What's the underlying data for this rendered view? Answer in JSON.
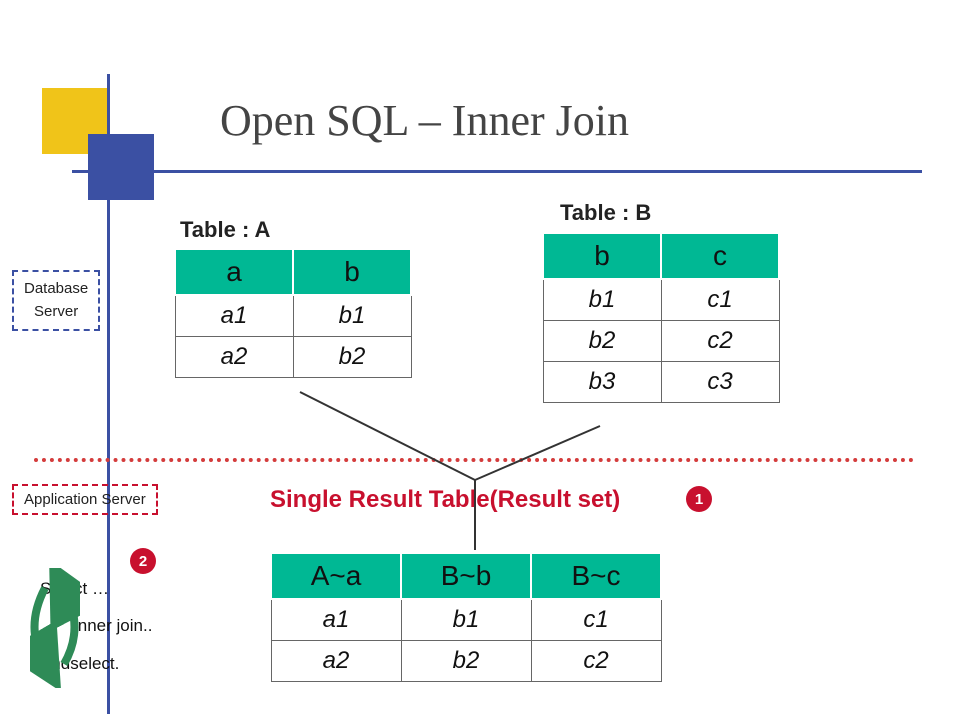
{
  "title": "Open SQL – Inner Join",
  "labels": {
    "tableA": "Table : A",
    "tableB": "Table : B",
    "dbServerLine1": "Database",
    "dbServerLine2": "Server",
    "appServer": "Application Server",
    "resultTitle": "Single Result Table(Result set)",
    "badge1": "1",
    "badge2": "2",
    "code1": "Select …",
    "code2": "inner join..",
    "code3": "Endselect."
  },
  "tableA": {
    "headers": [
      "a",
      "b"
    ],
    "rows": [
      [
        "a1",
        "b1"
      ],
      [
        "a2",
        "b2"
      ]
    ]
  },
  "tableB": {
    "headers": [
      "b",
      "c"
    ],
    "rows": [
      [
        "b1",
        "c1"
      ],
      [
        "b2",
        "c2"
      ],
      [
        "b3",
        "c3"
      ]
    ]
  },
  "result": {
    "headers": [
      "A~a",
      "B~b",
      "B~c"
    ],
    "rows": [
      [
        "a1",
        "b1",
        "c1"
      ],
      [
        "a2",
        "b2",
        "c2"
      ]
    ]
  }
}
